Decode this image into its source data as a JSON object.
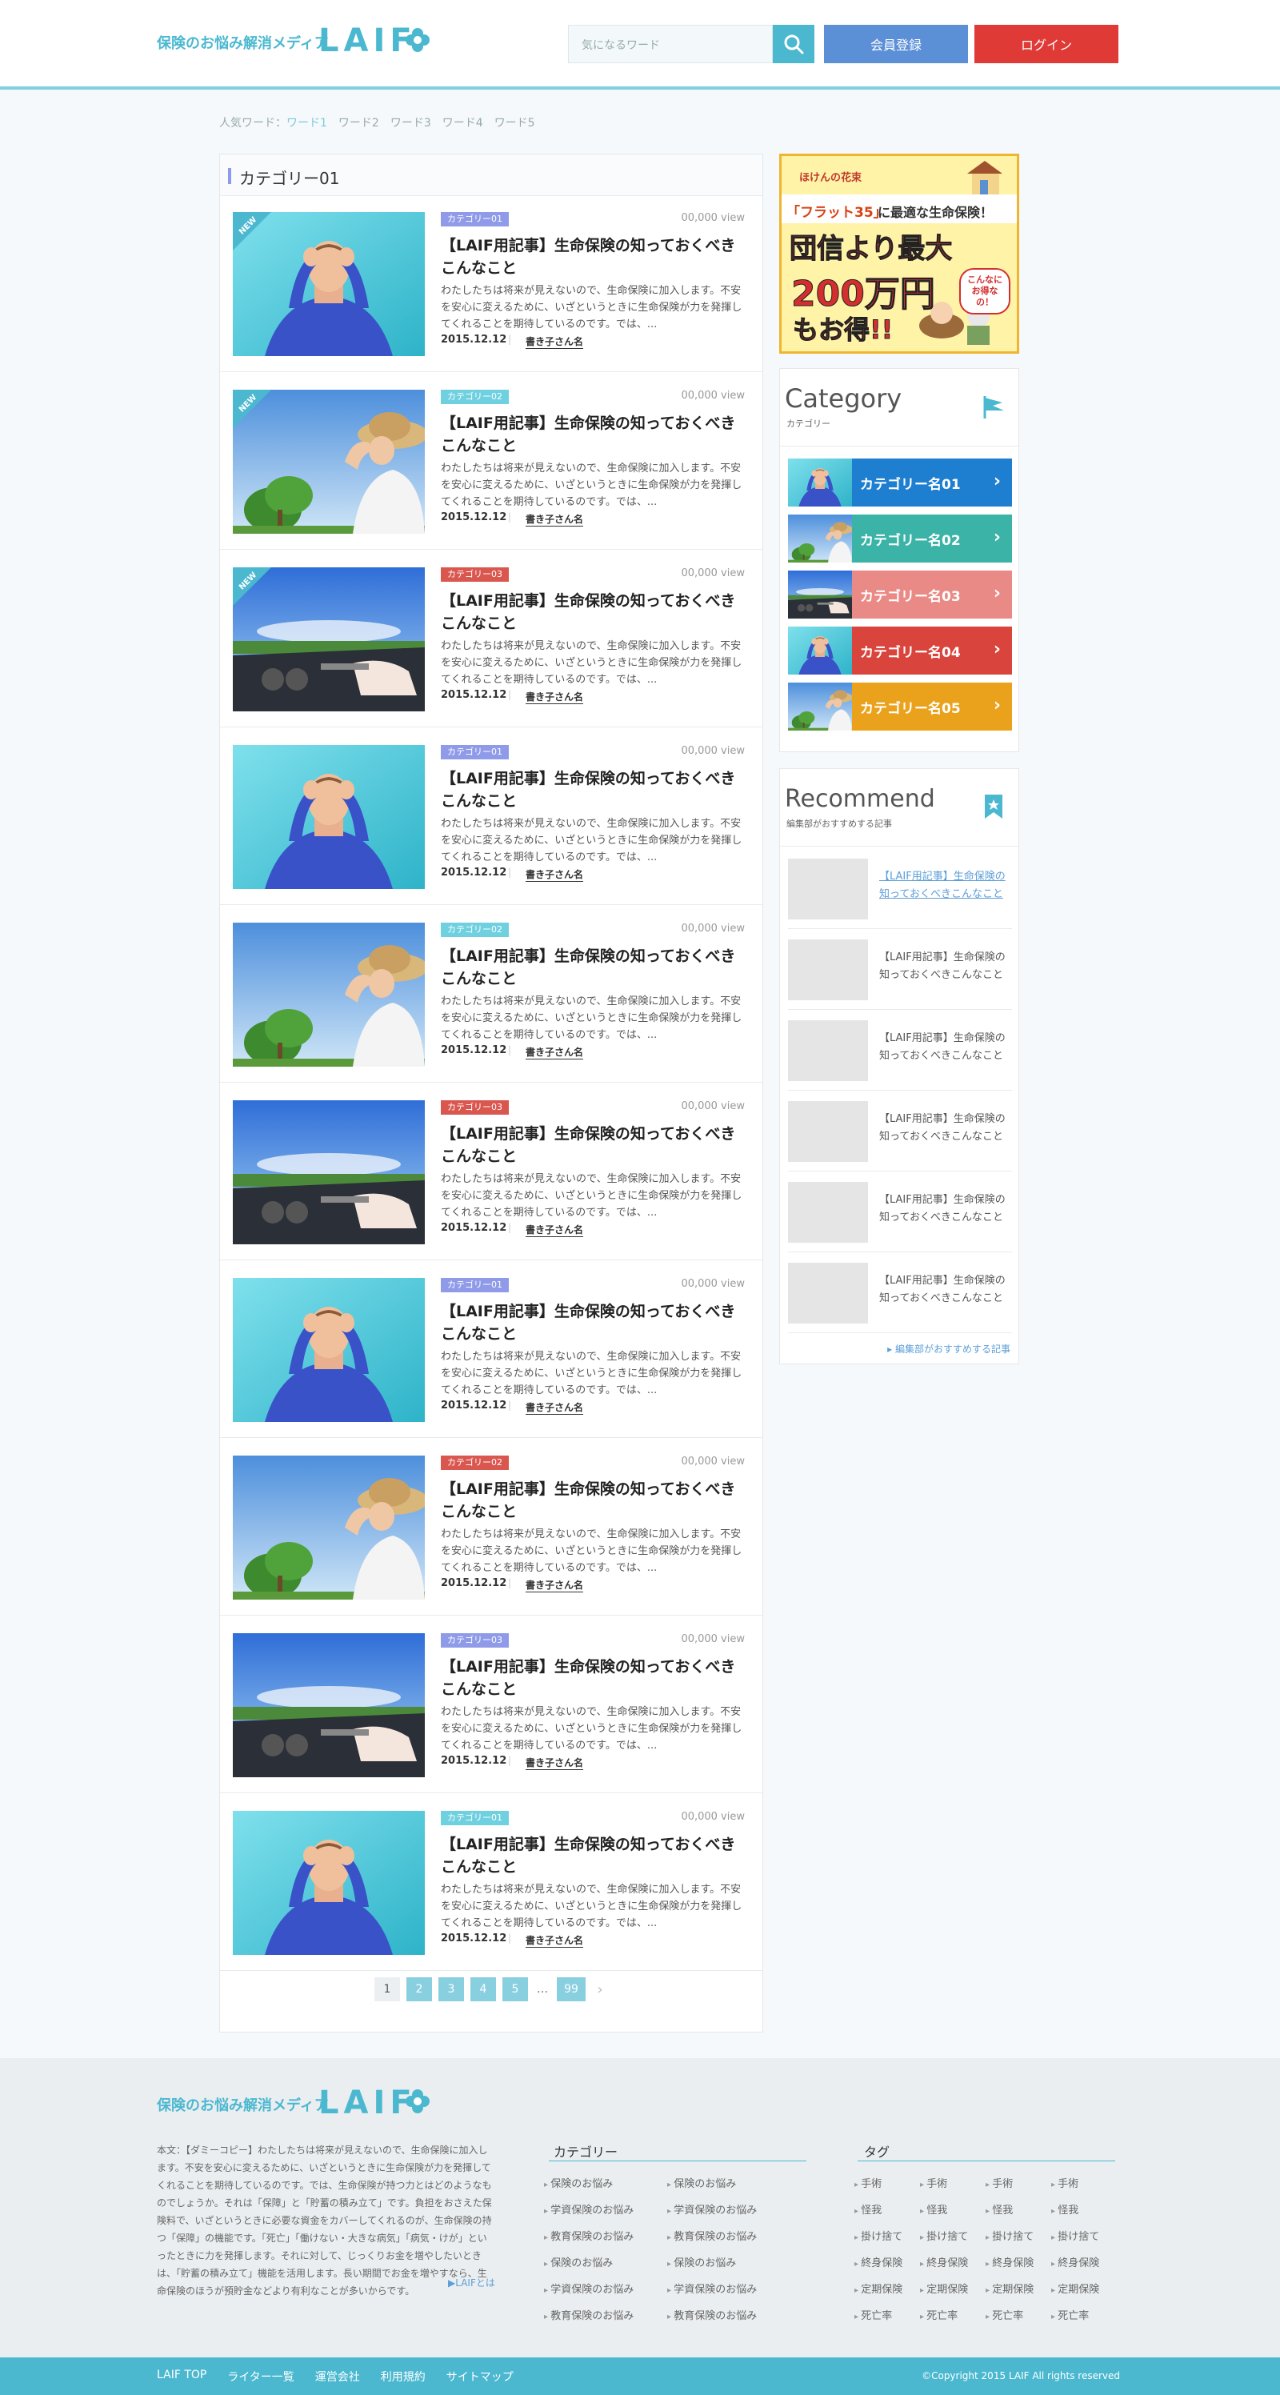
{
  "header": {
    "tagline": "保険のお悩み解消メディア",
    "brand": "LAIF",
    "search_placeholder": "気になるワード",
    "register_label": "会員登録",
    "login_label": "ログイン"
  },
  "popular": {
    "label": "人気ワード：",
    "words": [
      "ワード1",
      "ワード2",
      "ワード3",
      "ワード4",
      "ワード5"
    ]
  },
  "main": {
    "category_title": "カテゴリー01",
    "new_label": "NEW",
    "articles": [
      {
        "tag": "カテゴリー01",
        "tag_color": "#8f9be8",
        "views": "00,000 view",
        "title": "【LAIF用記事】生命保険の知っておくべきこんなこと",
        "body": "わたしたちは将来が見えないので、生命保険に加入します。不安を安心に変えるために、いざというときに生命保険が力を発揮してくれることを期待しているのです。では、...",
        "date": "2015.12.12",
        "author": "書き子さん名",
        "image": "man",
        "new": true
      },
      {
        "tag": "カテゴリー02",
        "tag_color": "#6fd0e0",
        "views": "00,000 view",
        "title": "【LAIF用記事】生命保険の知っておくべきこんなこと",
        "body": "わたしたちは将来が見えないので、生命保険に加入します。不安を安心に変えるために、いざというときに生命保険が力を発揮してくれることを期待しているのです。では、...",
        "date": "2015.12.12",
        "author": "書き子さん名",
        "image": "woman",
        "new": true
      },
      {
        "tag": "カテゴリー03",
        "tag_color": "#d9574f",
        "views": "00,000 view",
        "title": "【LAIF用記事】生命保険の知っておくべきこんなこと",
        "body": "わたしたちは将来が見えないので、生命保険に加入します。不安を安心に変えるために、いざというときに生命保険が力を発揮してくれることを期待しているのです。では、...",
        "date": "2015.12.12",
        "author": "書き子さん名",
        "image": "car",
        "new": true
      },
      {
        "tag": "カテゴリー01",
        "tag_color": "#8f9be8",
        "views": "00,000 view",
        "title": "【LAIF用記事】生命保険の知っておくべきこんなこと",
        "body": "わたしたちは将来が見えないので、生命保険に加入します。不安を安心に変えるために、いざというときに生命保険が力を発揮してくれることを期待しているのです。では、...",
        "date": "2015.12.12",
        "author": "書き子さん名",
        "image": "man",
        "new": false
      },
      {
        "tag": "カテゴリー02",
        "tag_color": "#6fd0e0",
        "views": "00,000 view",
        "title": "【LAIF用記事】生命保険の知っておくべきこんなこと",
        "body": "わたしたちは将来が見えないので、生命保険に加入します。不安を安心に変えるために、いざというときに生命保険が力を発揮してくれることを期待しているのです。では、...",
        "date": "2015.12.12",
        "author": "書き子さん名",
        "image": "woman",
        "new": false
      },
      {
        "tag": "カテゴリー03",
        "tag_color": "#d9574f",
        "views": "00,000 view",
        "title": "【LAIF用記事】生命保険の知っておくべきこんなこと",
        "body": "わたしたちは将来が見えないので、生命保険に加入します。不安を安心に変えるために、いざというときに生命保険が力を発揮してくれることを期待しているのです。では、...",
        "date": "2015.12.12",
        "author": "書き子さん名",
        "image": "car",
        "new": false
      },
      {
        "tag": "カテゴリー01",
        "tag_color": "#8f9be8",
        "views": "00,000 view",
        "title": "【LAIF用記事】生命保険の知っておくべきこんなこと",
        "body": "わたしたちは将来が見えないので、生命保険に加入します。不安を安心に変えるために、いざというときに生命保険が力を発揮してくれることを期待しているのです。では、...",
        "date": "2015.12.12",
        "author": "書き子さん名",
        "image": "man",
        "new": false
      },
      {
        "tag": "カテゴリー02",
        "tag_color": "#d9574f",
        "views": "00,000 view",
        "title": "【LAIF用記事】生命保険の知っておくべきこんなこと",
        "body": "わたしたちは将来が見えないので、生命保険に加入します。不安を安心に変えるために、いざというときに生命保険が力を発揮してくれることを期待しているのです。では、...",
        "date": "2015.12.12",
        "author": "書き子さん名",
        "image": "woman",
        "new": false
      },
      {
        "tag": "カテゴリー03",
        "tag_color": "#8f9be8",
        "views": "00,000 view",
        "title": "【LAIF用記事】生命保険の知っておくべきこんなこと",
        "body": "わたしたちは将来が見えないので、生命保険に加入します。不安を安心に変えるために、いざというときに生命保険が力を発揮してくれることを期待しているのです。では、...",
        "date": "2015.12.12",
        "author": "書き子さん名",
        "image": "car",
        "new": false
      },
      {
        "tag": "カテゴリー01",
        "tag_color": "#6fd0e0",
        "views": "00,000 view",
        "title": "【LAIF用記事】生命保険の知っておくべきこんなこと",
        "body": "わたしたちは将来が見えないので、生命保険に加入します。不安を安心に変えるために、いざというときに生命保険が力を発揮してくれることを期待しているのです。では、...",
        "date": "2015.12.12",
        "author": "書き子さん名",
        "image": "man",
        "new": false
      }
    ],
    "pager": {
      "pages": [
        "1",
        "2",
        "3",
        "4",
        "5"
      ],
      "dots": "…",
      "last": "99",
      "next": "›"
    }
  },
  "ad": {
    "brand": "ほけんの花束",
    "line1_a": "「フラット35」",
    "line1_b": "に最適な生命保険！",
    "line2": "団信より最大",
    "line3": "200万円",
    "line4": "もお得!!",
    "bubble": "こんなにお得なの！"
  },
  "category_panel": {
    "title": "Category",
    "subtitle": "カテゴリー",
    "items": [
      {
        "label": "カテゴリー名01",
        "color": "#1e7ed0",
        "image": "man"
      },
      {
        "label": "カテゴリー名02",
        "color": "#3bb3a6",
        "image": "woman"
      },
      {
        "label": "カテゴリー名03",
        "color": "#ea8a86",
        "image": "car"
      },
      {
        "label": "カテゴリー名04",
        "color": "#d9443c",
        "image": "man"
      },
      {
        "label": "カテゴリー名05",
        "color": "#eaa21c",
        "image": "woman"
      }
    ]
  },
  "recommend_panel": {
    "title": "Recommend",
    "subtitle": "編集部がおすすめする記事",
    "items": [
      "【LAIF用記事】生命保険の知っておくべきこんなこと",
      "【LAIF用記事】生命保険の知っておくべきこんなこと",
      "【LAIF用記事】生命保険の知っておくべきこんなこと",
      "【LAIF用記事】生命保険の知っておくべきこんなこと",
      "【LAIF用記事】生命保険の知っておくべきこんなこと",
      "【LAIF用記事】生命保険の知っておくべきこんなこと"
    ],
    "more": "▸ 編集部がおすすめする記事"
  },
  "footer": {
    "tagline": "保険のお悩み解消メディア",
    "brand": "LAIF",
    "body": "本文：【ダミーコピー】わたしたちは将来が見えないので、生命保険に加入します。不安を安心に変えるために、いざというときに生命保険が力を発揮してくれることを期待しているのです。では、生命保険が持つ力とはどのようなものでしょうか。それは「保障」と「貯蓄の積み立て」です。負担をおさえた保険料で、いざというときに必要な資金をカバーしてくれるのが、生命保険の持つ「保障」の機能です。「死亡」「働けない・大きな病気」「病気・けが」といったときに力を発揮します。それに対して、じっくりお金を増やしたいときは、「貯蓄の積み立て」機能を活用します。長い期間でお金を増やすなら、生命保険のほうが預貯金などより有利なことが多いからです。",
    "more": "▶LAIFとは",
    "category_title": "カテゴリー",
    "category_col1": [
      "保険のお悩み",
      "学資保険のお悩み",
      "教育保険のお悩み",
      "保険のお悩み",
      "学資保険のお悩み",
      "教育保険のお悩み"
    ],
    "category_col2": [
      "保険のお悩み",
      "学資保険のお悩み",
      "教育保険のお悩み",
      "保険のお悩み",
      "学資保険のお悩み",
      "教育保険のお悩み"
    ],
    "tag_title": "タグ",
    "tags": [
      [
        "手術",
        "手術",
        "手術",
        "手術"
      ],
      [
        "怪我",
        "怪我",
        "怪我",
        "怪我"
      ],
      [
        "掛け捨て",
        "掛け捨て",
        "掛け捨て",
        "掛け捨て"
      ],
      [
        "終身保険",
        "終身保険",
        "終身保険",
        "終身保険"
      ],
      [
        "定期保険",
        "定期保険",
        "定期保険",
        "定期保険"
      ],
      [
        "死亡率",
        "死亡率",
        "死亡率",
        "死亡率"
      ]
    ]
  },
  "bottom_bar": {
    "links": [
      "LAIF TOP",
      "ライター一覧",
      "運営会社",
      "利用規約",
      "サイトマップ"
    ],
    "copyright": "©Copyright 2015 LAIF All rights reserved"
  }
}
